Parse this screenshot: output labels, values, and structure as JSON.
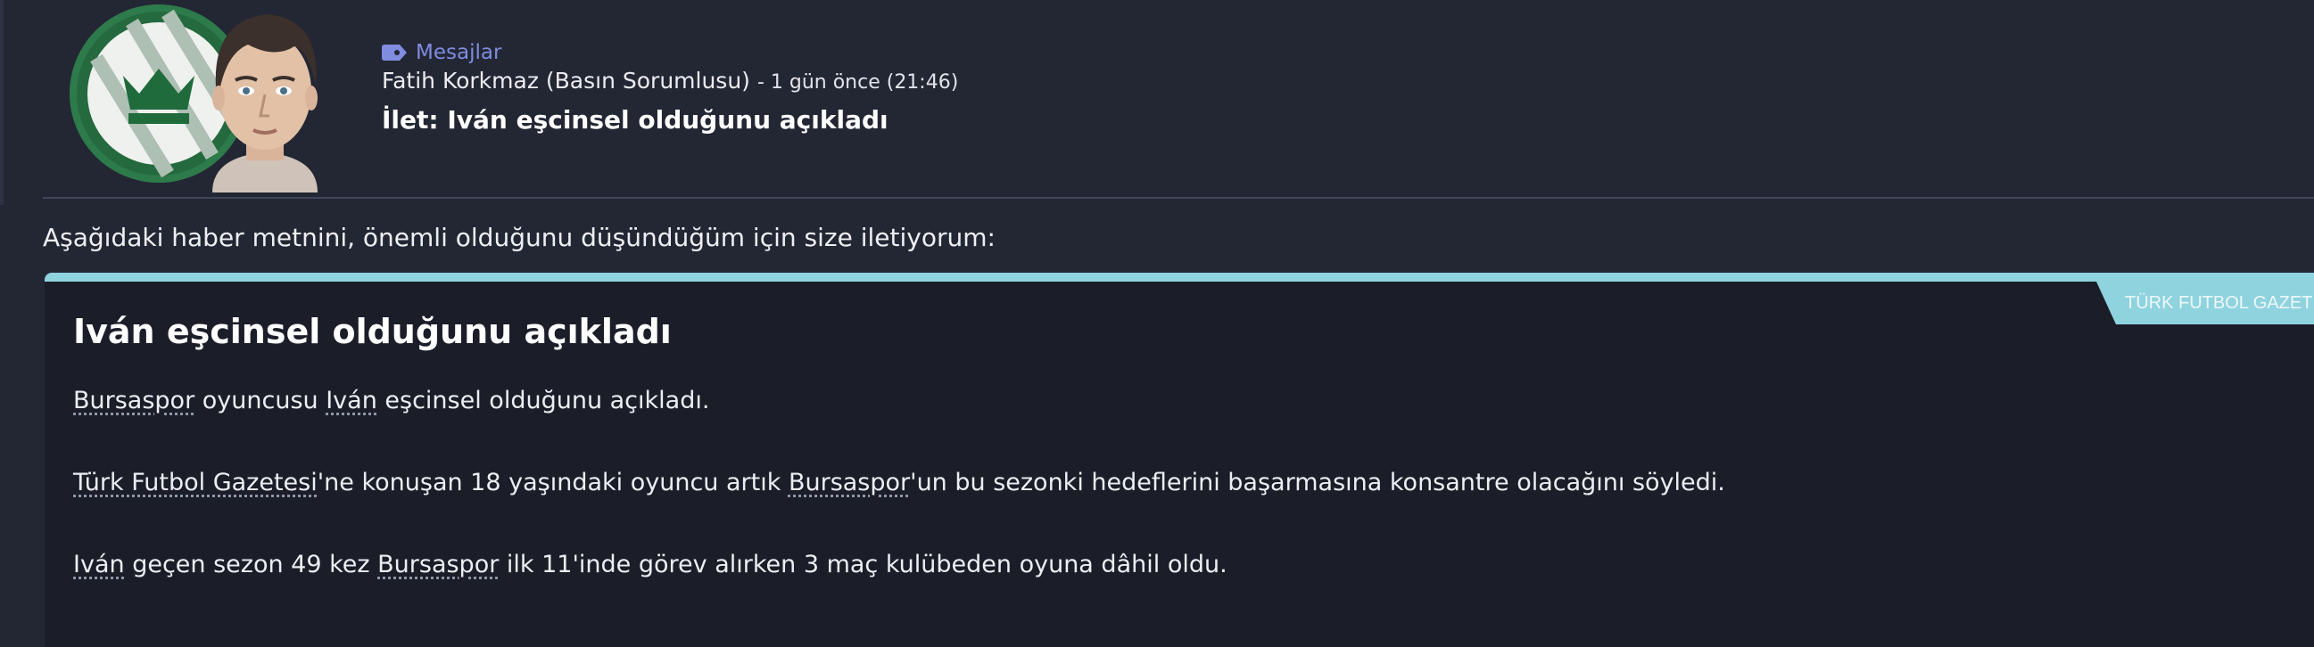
{
  "header": {
    "category": "Mesajlar",
    "sender": "Fatih Korkmaz (Basın Sorumlusu)",
    "time": "- 1 gün önce (21:46)",
    "subject": "İlet: Iván eşcinsel olduğunu açıkladı"
  },
  "message": {
    "intro": "Aşağıdaki haber metnini, önemli olduğunu düşündüğüm için size iletiyorum:"
  },
  "article": {
    "source": "TÜRK FUTBOL GAZETESİ",
    "title": "Iván eşcinsel olduğunu açıkladı",
    "p1": {
      "club": "Bursaspor",
      "t1": " oyuncusu ",
      "player": "Iván",
      "t2": " eşcinsel olduğunu açıkladı."
    },
    "p2": {
      "paper": "Türk Futbol Gazetesi",
      "t1": "'ne konuşan 18 yaşındaki oyuncu artık ",
      "club": "Bursaspor",
      "t2": "'un bu sezonki hedeflerini başarmasına konsantre olacağını söyledi."
    },
    "p3": {
      "player": "Iván",
      "t1": " geçen sezon 49 kez ",
      "club": "Bursaspor",
      "t2": " ilk 11'inde görev alırken 3 maç kulübeden oyuna dâhil oldu."
    }
  },
  "icons": {
    "category": "tag-icon",
    "club": "club-badge",
    "player": "player-avatar"
  },
  "colors": {
    "background": "#232734",
    "article_bg": "#1b1e29",
    "accent": "#8fd3de",
    "category": "#7f8ce0"
  }
}
